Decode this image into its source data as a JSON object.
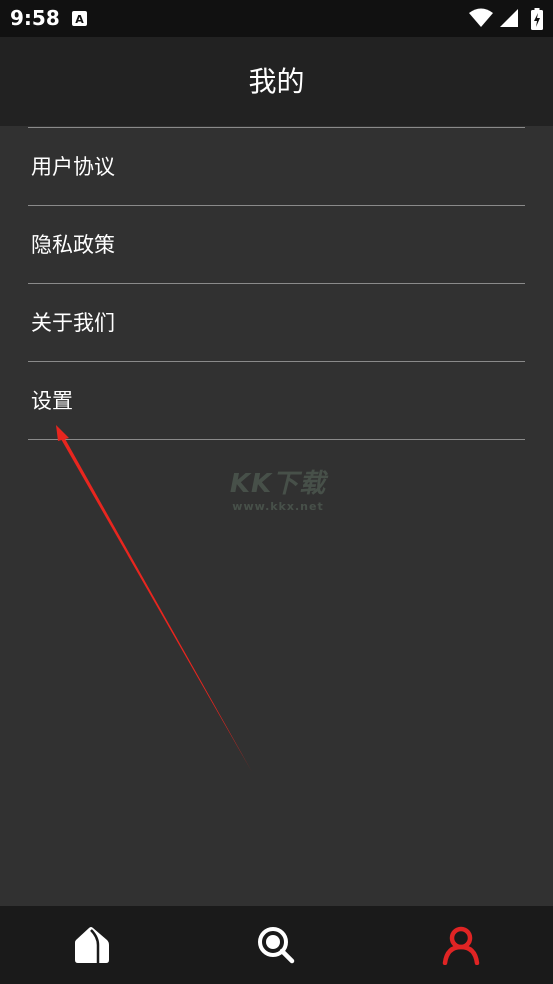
{
  "status_bar": {
    "time": "9:58",
    "app_icon_letter": "A",
    "icons": [
      "wifi-icon",
      "signal-icon",
      "battery-charging-icon"
    ]
  },
  "app_bar": {
    "title": "我的"
  },
  "menu": {
    "items": [
      {
        "label": "用户协议",
        "icon": "none"
      },
      {
        "label": "隐私政策",
        "icon": "none"
      },
      {
        "label": "关于我们",
        "icon": "none"
      },
      {
        "label": "设置",
        "icon": "none"
      }
    ]
  },
  "watermark": {
    "logo_text": "KK下载",
    "url": "www.kkx.net"
  },
  "bottom_nav": {
    "items": [
      {
        "name": "home",
        "icon": "home-icon",
        "active": false
      },
      {
        "name": "search",
        "icon": "search-icon",
        "active": false
      },
      {
        "name": "profile",
        "icon": "user-icon",
        "active": true
      }
    ]
  },
  "colors": {
    "background": "#313131",
    "app_bar": "#222222",
    "status_bar": "#111111",
    "divider": "#8a8a8a",
    "active_nav": "#e02424",
    "annotation_arrow": "#e8261f"
  }
}
